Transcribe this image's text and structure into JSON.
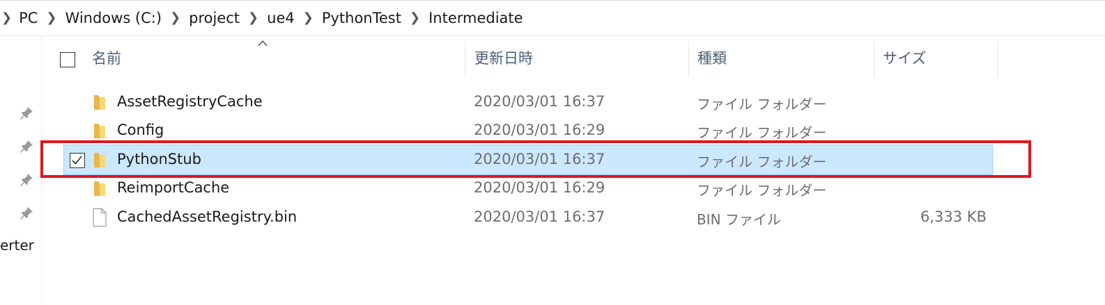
{
  "breadcrumb": {
    "items": [
      "PC",
      "Windows (C:)",
      "project",
      "ue4",
      "PythonTest",
      "Intermediate"
    ]
  },
  "nav": {
    "partial_label": "erter"
  },
  "columns": {
    "name": "名前",
    "modified": "更新日時",
    "type": "種類",
    "size": "サイズ"
  },
  "files": [
    {
      "name": "AssetRegistryCache",
      "modified": "2020/03/01 16:37",
      "type": "ファイル フォルダー",
      "size": "",
      "icon": "folder-icon",
      "selected": false
    },
    {
      "name": "Config",
      "modified": "2020/03/01 16:29",
      "type": "ファイル フォルダー",
      "size": "",
      "icon": "folder-icon",
      "selected": false
    },
    {
      "name": "PythonStub",
      "modified": "2020/03/01 16:37",
      "type": "ファイル フォルダー",
      "size": "",
      "icon": "folder-icon",
      "selected": true
    },
    {
      "name": "ReimportCache",
      "modified": "2020/03/01 16:29",
      "type": "ファイル フォルダー",
      "size": "",
      "icon": "folder-icon",
      "selected": false
    },
    {
      "name": "CachedAssetRegistry.bin",
      "modified": "2020/03/01 16:37",
      "type": "BIN ファイル",
      "size": "6,333 KB",
      "icon": "file-icon",
      "selected": false
    }
  ],
  "colors": {
    "selection_bg": "#cce8ff",
    "selection_border": "#99d1ff",
    "highlight": "#e3141c",
    "folder": "#f8d775"
  }
}
